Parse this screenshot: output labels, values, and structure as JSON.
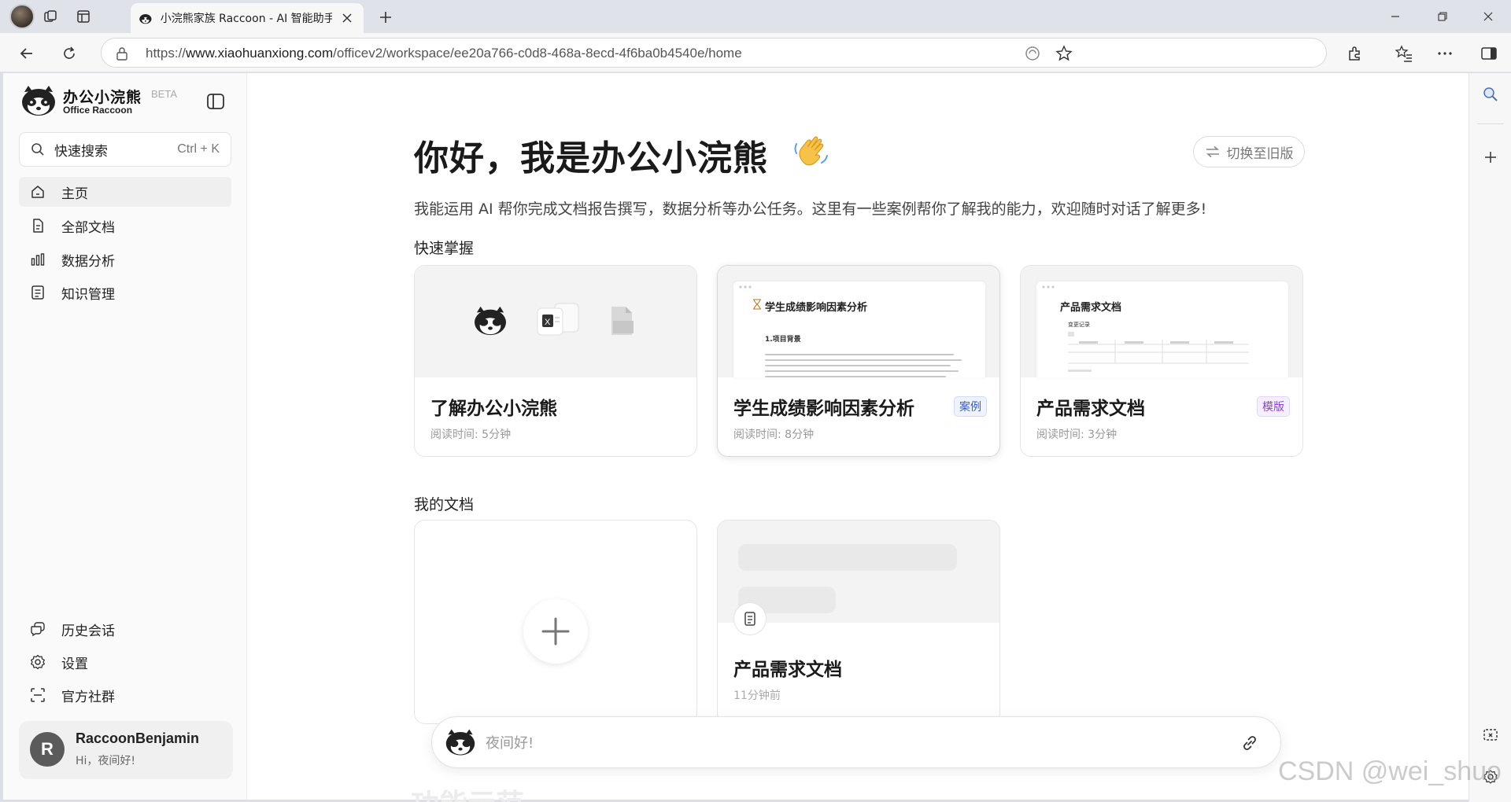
{
  "browser": {
    "tab_title": "小浣熊家族 Raccoon - AI 智能助手",
    "url_prefix": "https://",
    "url_host": "www.xiaohuanxiong.com",
    "url_path": "/officev2/workspace/ee20a766-c0d8-468a-8ecd-4f6ba0b4540e/home"
  },
  "sidebar": {
    "brand_name": "办公小浣熊",
    "brand_sub": "Office Raccoon",
    "beta": "BETA",
    "search_label": "快速搜索",
    "search_shortcut": "Ctrl + K",
    "nav": [
      {
        "label": "主页",
        "icon": "home-icon"
      },
      {
        "label": "全部文档",
        "icon": "document-icon"
      },
      {
        "label": "数据分析",
        "icon": "bar-chart-icon"
      },
      {
        "label": "知识管理",
        "icon": "notebook-icon"
      }
    ],
    "bottom_nav": [
      {
        "label": "历史会话",
        "icon": "chat-history-icon"
      },
      {
        "label": "设置",
        "icon": "gear-icon"
      },
      {
        "label": "官方社群",
        "icon": "scan-icon"
      }
    ],
    "user": {
      "initial": "R",
      "name": "RaccoonBenjamin",
      "greeting": "Hi，夜间好!"
    }
  },
  "main": {
    "greeting": "你好，我是办公小浣熊",
    "switch_label": "切换至旧版",
    "intro": "我能运用 AI 帮你完成文档报告撰写，数据分析等办公任务。这里有一些案例帮你了解我的能力，欢迎随时对话了解更多!",
    "quick_title": "快速掌握",
    "cards": [
      {
        "title": "了解办公小浣熊",
        "meta": "阅读时间: 5分钟",
        "tag": ""
      },
      {
        "title": "学生成绩影响因素分析",
        "meta": "阅读时间: 8分钟",
        "tag": "案例",
        "thumb_title": "学生成绩影响因素分析",
        "thumb_h2": "1.项目背景"
      },
      {
        "title": "产品需求文档",
        "meta": "阅读时间: 3分钟",
        "tag": "模版",
        "thumb_title": "产品需求文档",
        "thumb_h2": "变更记录"
      }
    ],
    "my_docs_title": "我的文档",
    "docs": [
      {
        "title": "产品需求文档",
        "meta": "11分钟前"
      }
    ],
    "chat_placeholder": "夜间好!",
    "faded_heading": "功能示范"
  },
  "watermark": "CSDN @wei_shuo",
  "colors": {
    "accent_blue": "#2f5bd6",
    "accent_purple": "#8a3fd6",
    "sidebar_bg": "#fafafa",
    "card_top_bg": "#f3f3f3"
  }
}
